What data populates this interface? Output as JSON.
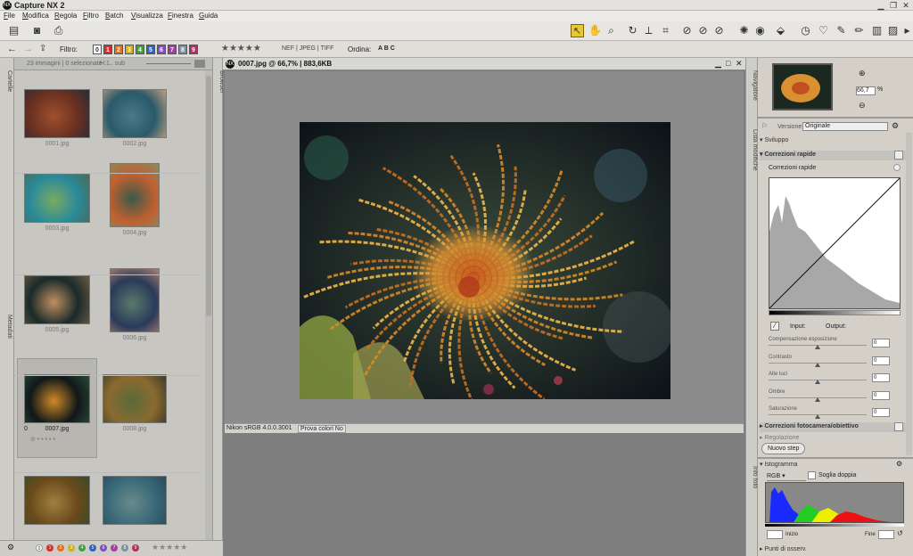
{
  "app": {
    "title": "Capture NX 2",
    "logo_text": "NX"
  },
  "menu": [
    "File",
    "Modifica",
    "Regola",
    "Filtro",
    "Batch",
    "Visualizza",
    "Finestra",
    "Guida"
  ],
  "filterbar": {
    "filter_label": "Filtro:",
    "labels": [
      "0",
      "1",
      "2",
      "3",
      "4",
      "5",
      "6",
      "7",
      "8",
      "9"
    ],
    "label_colors": [
      "#ffffff",
      "#d03030",
      "#e07020",
      "#d0b020",
      "#40a040",
      "#3060c0",
      "#8050c0",
      "#a040a0",
      "#8090a0",
      "#b03060"
    ],
    "rating": "★★★★★",
    "formats": "NEF | JPEG | TIFF",
    "sort_label": "Ordina:",
    "sort_value": "A B C"
  },
  "left_tabs": {
    "folders": "Cartelle",
    "metadata": "Metadati"
  },
  "browser": {
    "summary": "23 immagini | 0 selezionate",
    "sort_hint": "H:1.. sub",
    "tab_label": "Browser",
    "thumbnails": [
      {
        "name": "0001.jpg"
      },
      {
        "name": "0002.jpg"
      },
      {
        "name": "0003.jpg"
      },
      {
        "name": "0004.jpg"
      },
      {
        "name": "0005.jpg"
      },
      {
        "name": "0006.jpg"
      },
      {
        "name": "0007.jpg",
        "selected": true,
        "label": "0"
      },
      {
        "name": "0008.jpg"
      },
      {
        "name": ""
      },
      {
        "name": ""
      }
    ]
  },
  "document": {
    "title": "0007.jpg @ 66,7% | 883,6KB",
    "profile": "Nikon sRGB 4.0.0.3001",
    "proof": "Prova colori No"
  },
  "right_tabs": {
    "navigator": "Navigatore",
    "edit_list": "Lista modifiche",
    "photo_info": "Info foto"
  },
  "navigator": {
    "zoom": "66,7",
    "unit": "%"
  },
  "edit_list": {
    "version_label": "Versione",
    "version_value": "Originale",
    "develop": "Sviluppo",
    "quick_fix_header": "Correzioni rapide",
    "quick_fix_sub": "Correzioni rapide",
    "input_label": "Input:",
    "output_label": "Output:",
    "sliders": [
      {
        "label": "Compensazione esposizione",
        "value": "0"
      },
      {
        "label": "Contrasto",
        "value": "0"
      },
      {
        "label": "Alte luci",
        "value": "0"
      },
      {
        "label": "Ombre",
        "value": "0"
      },
      {
        "label": "Saturazione",
        "value": "0"
      }
    ],
    "camera_lens": "Correzioni fotocamera/obiettivo",
    "adjust": "Regolazione",
    "new_step": "Nuovo step"
  },
  "histogram": {
    "title": "Istogramma",
    "channel": "RGB",
    "double_threshold": "Soglia doppia",
    "start_label": "Inizio",
    "end_label": "Fine"
  },
  "points": "Punti di osserv."
}
